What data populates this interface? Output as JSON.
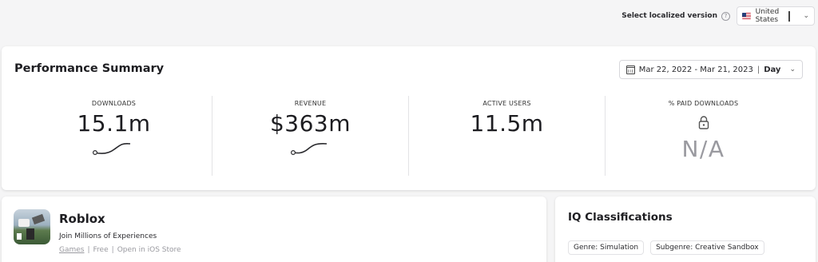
{
  "locale": {
    "label": "Select localized version",
    "help_icon": "?",
    "selected": "United States",
    "flag_icon": "us-flag-icon",
    "chevron_icon": "chevron-down-icon"
  },
  "performance": {
    "title": "Performance Summary",
    "date_range": "Mar 22, 2022 - Mar 21, 2023",
    "separator": "|",
    "granularity": "Day",
    "metrics": [
      {
        "label": "DOWNLOADS",
        "value": "15.1m",
        "trend": "up"
      },
      {
        "label": "REVENUE",
        "value": "$363m",
        "trend": "up"
      },
      {
        "label": "ACTIVE USERS",
        "value": "11.5m"
      },
      {
        "label": "% PAID DOWNLOADS",
        "value": "N/A",
        "locked": true
      }
    ]
  },
  "app": {
    "name": "Roblox",
    "tagline": "Join Millions of Experiences",
    "category": "Games",
    "price": "Free",
    "store_link": "Open in iOS Store",
    "meta_separator": "|"
  },
  "iq": {
    "title": "IQ Classifications",
    "chips": [
      "Genre: Simulation",
      "Subgenre: Creative Sandbox"
    ]
  },
  "colors": {
    "background": "#f5f5f6",
    "card": "#ffffff",
    "text": "#1f1f24",
    "muted": "#9a9aa0"
  }
}
